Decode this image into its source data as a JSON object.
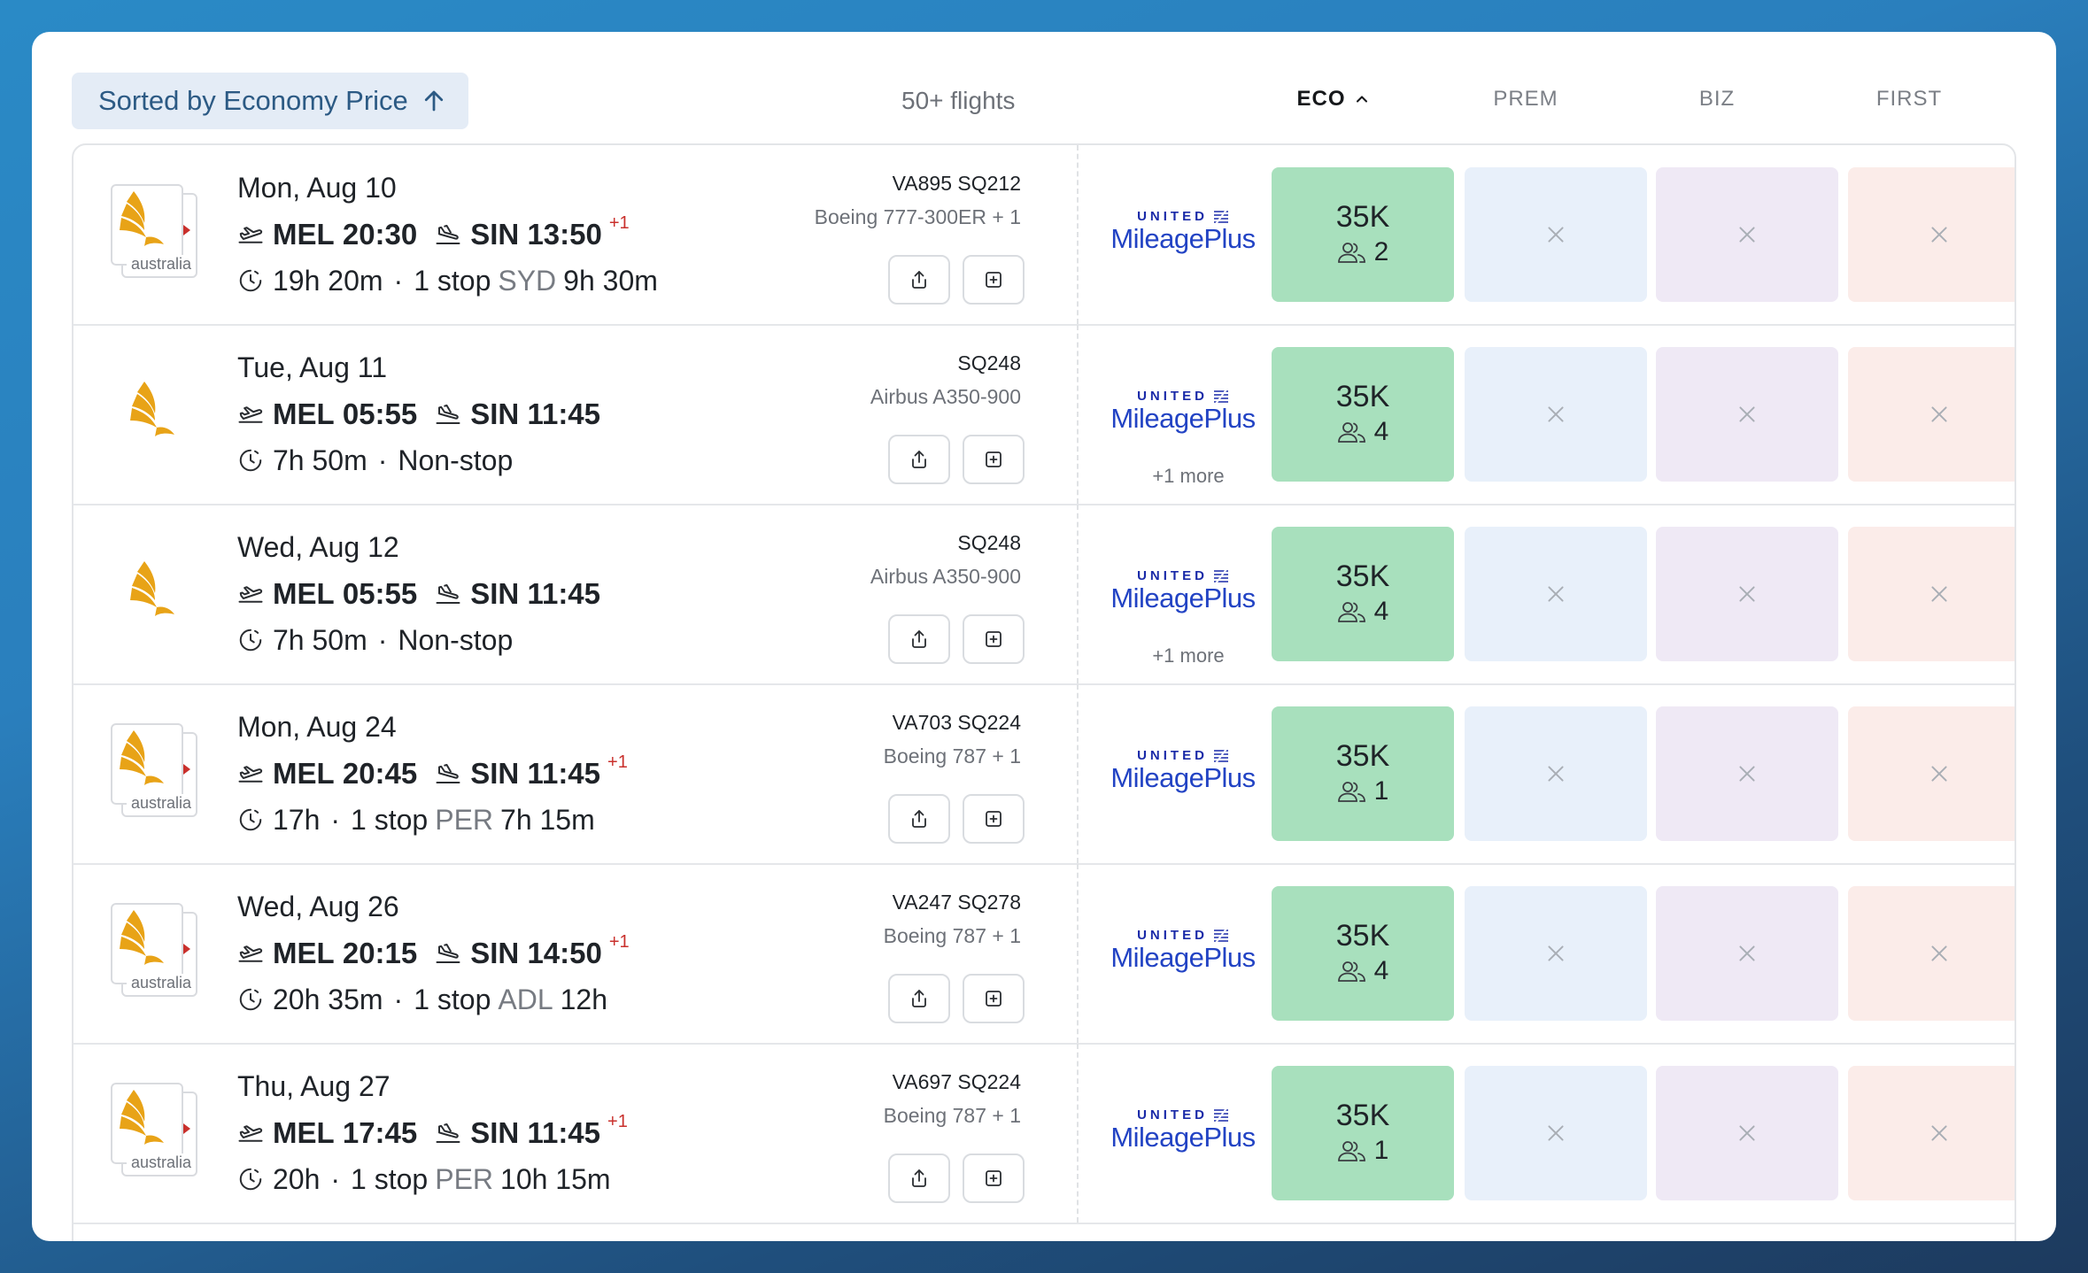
{
  "toolbar": {
    "sort_label": "Sorted by Economy Price",
    "flight_count": "50+ flights",
    "cabins": [
      "ECO",
      "PREM",
      "BIZ",
      "FIRST"
    ],
    "active_cabin": "ECO"
  },
  "colors": {
    "eco": "#a8e0bd",
    "prem": "#e8f0fa",
    "biz": "#efe9f5",
    "first": "#fbece9",
    "united_blue": "#2243c4",
    "logo_gold": "#e8a317"
  },
  "program": {
    "top": "UNITED",
    "name": "MileagePlus"
  },
  "flights": [
    {
      "date": "Mon, Aug 10",
      "dep_airport": "MEL",
      "dep_time": "20:30",
      "arr_airport": "SIN",
      "arr_time": "13:50",
      "arr_plus": "+1",
      "duration": "19h 20m",
      "stops": "1 stop",
      "via": "SYD",
      "layover": "9h 30m",
      "codes": "VA895  SQ212",
      "aircraft": "Boeing 777-300ER + 1",
      "more": "",
      "eco_price": "35K",
      "eco_seats": "2",
      "logo": "va"
    },
    {
      "date": "Tue, Aug 11",
      "dep_airport": "MEL",
      "dep_time": "05:55",
      "arr_airport": "SIN",
      "arr_time": "11:45",
      "arr_plus": "",
      "duration": "7h 50m",
      "stops": "Non-stop",
      "via": "",
      "layover": "",
      "codes": "SQ248",
      "aircraft": "Airbus A350-900",
      "more": "+1 more",
      "eco_price": "35K",
      "eco_seats": "4",
      "logo": "sq"
    },
    {
      "date": "Wed, Aug 12",
      "dep_airport": "MEL",
      "dep_time": "05:55",
      "arr_airport": "SIN",
      "arr_time": "11:45",
      "arr_plus": "",
      "duration": "7h 50m",
      "stops": "Non-stop",
      "via": "",
      "layover": "",
      "codes": "SQ248",
      "aircraft": "Airbus A350-900",
      "more": "+1 more",
      "eco_price": "35K",
      "eco_seats": "4",
      "logo": "sq"
    },
    {
      "date": "Mon, Aug 24",
      "dep_airport": "MEL",
      "dep_time": "20:45",
      "arr_airport": "SIN",
      "arr_time": "11:45",
      "arr_plus": "+1",
      "duration": "17h",
      "stops": "1 stop",
      "via": "PER",
      "layover": "7h 15m",
      "codes": "VA703  SQ224",
      "aircraft": "Boeing 787 + 1",
      "more": "",
      "eco_price": "35K",
      "eco_seats": "1",
      "logo": "va"
    },
    {
      "date": "Wed, Aug 26",
      "dep_airport": "MEL",
      "dep_time": "20:15",
      "arr_airport": "SIN",
      "arr_time": "14:50",
      "arr_plus": "+1",
      "duration": "20h 35m",
      "stops": "1 stop",
      "via": "ADL",
      "layover": "12h",
      "codes": "VA247  SQ278",
      "aircraft": "Boeing 787 + 1",
      "more": "",
      "eco_price": "35K",
      "eco_seats": "4",
      "logo": "va"
    },
    {
      "date": "Thu, Aug 27",
      "dep_airport": "MEL",
      "dep_time": "17:45",
      "arr_airport": "SIN",
      "arr_time": "11:45",
      "arr_plus": "+1",
      "duration": "20h",
      "stops": "1 stop",
      "via": "PER",
      "layover": "10h 15m",
      "codes": "VA697  SQ224",
      "aircraft": "Boeing 787 + 1",
      "more": "",
      "eco_price": "35K",
      "eco_seats": "1",
      "logo": "va"
    }
  ],
  "logo_text": {
    "va_caption": "australia"
  }
}
